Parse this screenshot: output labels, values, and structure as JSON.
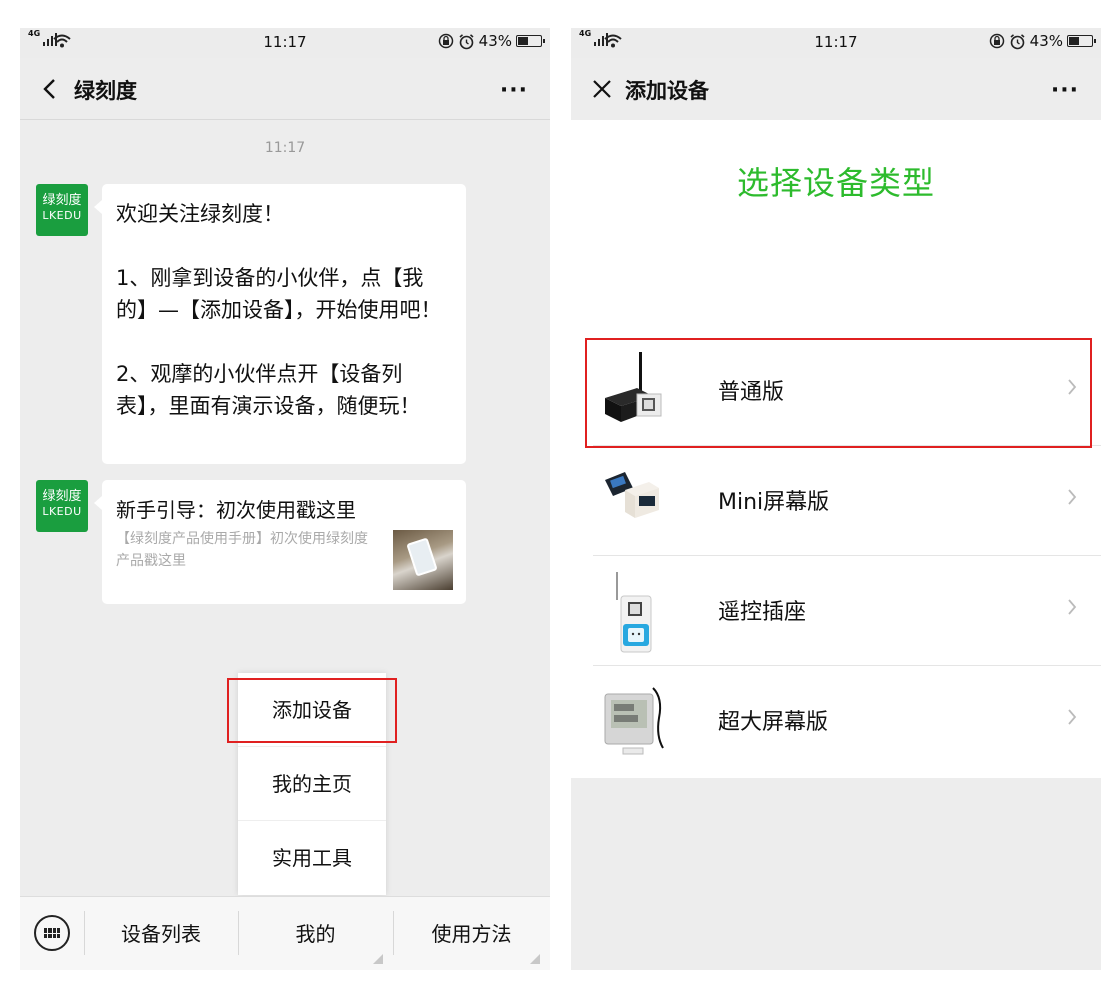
{
  "status": {
    "time": "11:17",
    "battery": "43%",
    "network": "4G",
    "battery_level": 0.43
  },
  "left": {
    "nav": {
      "title": "绿刻度"
    },
    "chat_time": "11:17",
    "avatar": {
      "line1": "绿刻度",
      "line2": "LKEDU"
    },
    "welcome_message": "欢迎关注绿刻度！\n\n1、刚拿到设备的小伙伴，点【我的】—【添加设备】，开始使用吧！\n\n2、观摩的小伙伴点开【设备列表】，里面有演示设备，随便玩！",
    "article_card": {
      "title": "新手引导：初次使用戳这里",
      "description": "【绿刻度产品使用手册】初次使用绿刻度产品戳这里"
    },
    "popup_menu": [
      "添加设备",
      "我的主页",
      "实用工具"
    ],
    "bottom_menu": [
      "设备列表",
      "我的",
      "使用方法"
    ]
  },
  "right": {
    "nav": {
      "title": "添加设备"
    },
    "select_title": "选择设备类型",
    "devices": [
      {
        "name": "普通版"
      },
      {
        "name": "Mini屏幕版"
      },
      {
        "name": "遥控插座"
      },
      {
        "name": "超大屏幕版"
      }
    ]
  },
  "colors": {
    "accent_green": "#2dbb2d",
    "highlight_red": "#e02020",
    "avatar_green": "#1a9e3f"
  },
  "icons": [
    "back-icon",
    "close-icon",
    "more-icon",
    "keyboard-icon",
    "chevron-right-icon",
    "wifi-icon",
    "alarm-icon",
    "lock-rotation-icon",
    "battery-icon"
  ]
}
